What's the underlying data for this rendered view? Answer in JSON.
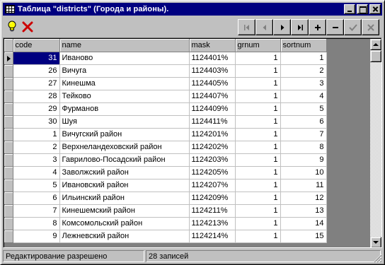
{
  "window": {
    "title": "Таблица \"districts\" (Города и районы).",
    "icon": "table-icon"
  },
  "toolbar": {
    "tools": [
      {
        "name": "hint-bulb-icon",
        "color": "#ffff00"
      },
      {
        "name": "delete-x-icon",
        "color": "#cc0000"
      }
    ],
    "navigator": [
      "first-record-icon",
      "prior-record-icon",
      "next-record-icon",
      "last-record-icon",
      "insert-record-icon",
      "delete-record-icon",
      "post-edit-icon",
      "cancel-edit-icon"
    ]
  },
  "grid": {
    "columns": [
      "code",
      "name",
      "mask",
      "grnum",
      "sortnum"
    ],
    "rows": [
      {
        "code": "31",
        "name": "Иваново",
        "mask": "1124401%",
        "grnum": "1",
        "sortnum": "1"
      },
      {
        "code": "26",
        "name": "Вичуга",
        "mask": "1124403%",
        "grnum": "1",
        "sortnum": "2"
      },
      {
        "code": "27",
        "name": "Кинешма",
        "mask": "1124405%",
        "grnum": "1",
        "sortnum": "3"
      },
      {
        "code": "28",
        "name": "Тейково",
        "mask": "1124407%",
        "grnum": "1",
        "sortnum": "4"
      },
      {
        "code": "29",
        "name": "Фурманов",
        "mask": "1124409%",
        "grnum": "1",
        "sortnum": "5"
      },
      {
        "code": "30",
        "name": "Шуя",
        "mask": "1124411%",
        "grnum": "1",
        "sortnum": "6"
      },
      {
        "code": "1",
        "name": "Вичугский район",
        "mask": "1124201%",
        "grnum": "1",
        "sortnum": "7"
      },
      {
        "code": "2",
        "name": "Верхнеландеховский район",
        "mask": "1124202%",
        "grnum": "1",
        "sortnum": "8"
      },
      {
        "code": "3",
        "name": "Гаврилово-Посадский район",
        "mask": "1124203%",
        "grnum": "1",
        "sortnum": "9"
      },
      {
        "code": "4",
        "name": "Заволжский район",
        "mask": "1124205%",
        "grnum": "1",
        "sortnum": "10"
      },
      {
        "code": "5",
        "name": "Ивановский район",
        "mask": "1124207%",
        "grnum": "1",
        "sortnum": "11"
      },
      {
        "code": "6",
        "name": "Ильинский район",
        "mask": "1124209%",
        "grnum": "1",
        "sortnum": "12"
      },
      {
        "code": "7",
        "name": "Кинешемский район",
        "mask": "1124211%",
        "grnum": "1",
        "sortnum": "13"
      },
      {
        "code": "8",
        "name": "Комсомольский район",
        "mask": "1124213%",
        "grnum": "1",
        "sortnum": "14"
      },
      {
        "code": "9",
        "name": "Лежневский район",
        "mask": "1124214%",
        "grnum": "1",
        "sortnum": "15"
      }
    ],
    "selected_row": 0,
    "selection_color": "#000080"
  },
  "status": {
    "mode": "Редактирование разрешено",
    "count": "28 записей"
  }
}
